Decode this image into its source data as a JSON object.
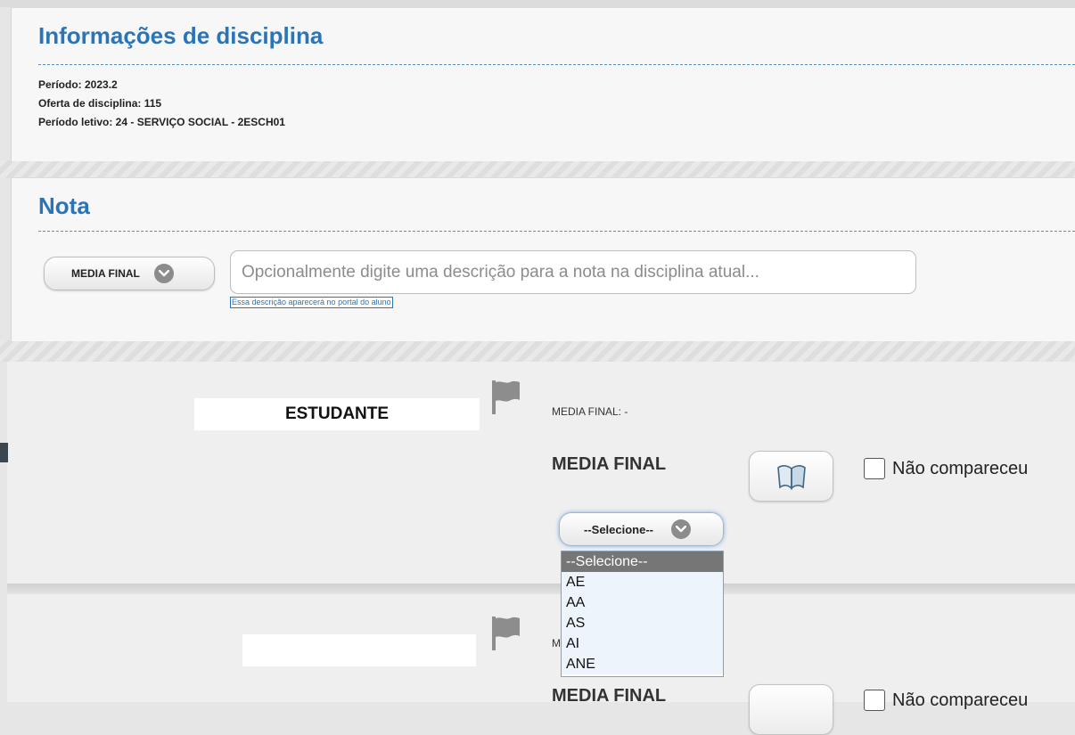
{
  "info": {
    "title": "Informações de disciplina",
    "lines": [
      "Período: 2023.2",
      "Oferta de disciplina: 115",
      "Período letivo: 24 - SERVIÇO SOCIAL - 2ESCH01"
    ]
  },
  "nota": {
    "title": "Nota",
    "type_select_label": "MEDIA FINAL",
    "description_placeholder": "Opcionalmente digite uma descrição para a nota na disciplina atual...",
    "hint": "Essa descrição aparecerá no portal do aluno"
  },
  "students": [
    {
      "name": "ESTUDANTE",
      "grade_summary": "MEDIA FINAL: -",
      "grade_label": "MEDIA FINAL",
      "absent_label": "Não compareceu",
      "select_value": "--Selecione--"
    },
    {
      "name": "",
      "grade_summary": "M",
      "grade_label": "MEDIA FINAL",
      "absent_label": "Não compareceu"
    }
  ],
  "dropdown": {
    "options": [
      "--Selecione--",
      "AE",
      "AA",
      "AS",
      "AI",
      "ANE"
    ],
    "selected": "--Selecione--"
  },
  "icons": {
    "chevron": "chevron-down-icon",
    "flag": "flag-icon",
    "book": "book-icon"
  }
}
